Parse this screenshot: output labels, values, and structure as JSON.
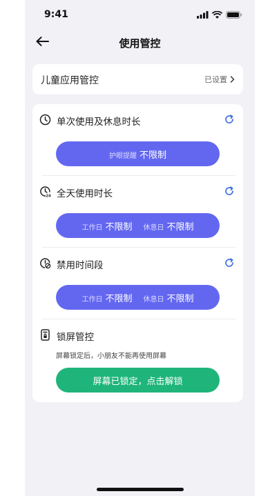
{
  "status": {
    "time": "9:41"
  },
  "nav": {
    "title": "使用管控"
  },
  "kids_app": {
    "title": "儿童应用管控",
    "status": "已设置"
  },
  "sections": {
    "single": {
      "title": "单次使用及休息时长",
      "label": "护眼提醒",
      "value": "不限制"
    },
    "daily": {
      "title": "全天使用时长",
      "workday_label": "工作日",
      "workday_value": "不限制",
      "restday_label": "休息日",
      "restday_value": "不限制"
    },
    "banned": {
      "title": "禁用时间段",
      "workday_label": "工作日",
      "workday_value": "不限制",
      "restday_label": "休息日",
      "restday_value": "不限制"
    },
    "lock": {
      "title": "锁屏管控",
      "description": "屏幕锁定后，小朋友不能再使用屏幕",
      "button": "屏幕已锁定，点击解锁"
    }
  },
  "colors": {
    "accent_blue": "#6367f0",
    "lock_green": "#1fb57a",
    "refresh_blue": "#3b6fe0"
  }
}
